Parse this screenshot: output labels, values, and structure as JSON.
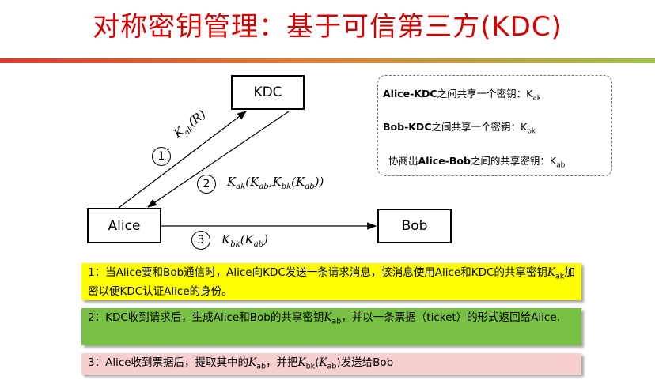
{
  "title": "对称密钥管理：基于可信第三方(KDC)",
  "nodes": {
    "kdc": "KDC",
    "alice": "Alice",
    "bob": "Bob"
  },
  "messages": {
    "m1": {
      "num": "1",
      "K": "K",
      "sub": "ak",
      "rest": "(R)"
    },
    "m2": {
      "num": "2",
      "K": "K",
      "sub": "ak",
      "open": "(",
      "K2": "K",
      "sub2": "ab",
      "comma": ",",
      "K3": "K",
      "sub3": "bk",
      "open2": "(",
      "K4": "K",
      "sub4": "ab",
      "close": "))"
    },
    "m3": {
      "num": "3",
      "K": "K",
      "sub": "bk",
      "open": "(",
      "K2": "K",
      "sub2": "ab",
      "close": ")"
    }
  },
  "info": {
    "line1": {
      "bold": "Alice-KDC",
      "text": "之间共享一个密钥：K",
      "sub": "ak"
    },
    "line2": {
      "bold": "Bob-KDC",
      "text": "之间共享一个密钥：K",
      "sub": "bk"
    },
    "line3": {
      "pre": "协商出",
      "bold": "Alice-Bob",
      "text": "之间的共享密钥：K",
      "sub": "ab"
    }
  },
  "steps": {
    "s1": {
      "a": "1：当Alice要和Bob通信时，Alice向KDC发送一条请求消息，该消息使用Alice和KDC的共享密钥",
      "K": "K",
      "sub": "ak",
      "b": "加密以便KDC认证Alice的身份。"
    },
    "s2": {
      "a": "2：KDC收到请求后，生成Alice和Bob的共享密钥",
      "K": "K",
      "sub": "ab",
      "b": "，并以一条票据（ticket）的形式返回给Alice."
    },
    "s3": {
      "a": "3：Alice收到票据后，提取其中的",
      "K": "K",
      "sub": "ab",
      "b": "，并把",
      "K2": "K",
      "sub2": "bk",
      "c": "(",
      "K3": "K",
      "sub3": "ab",
      "d": ")发送给Bob"
    }
  },
  "colors": {
    "title": "#d40000",
    "step1": "#ffff00",
    "step2": "#77c043",
    "step3": "#f7cfcf"
  }
}
